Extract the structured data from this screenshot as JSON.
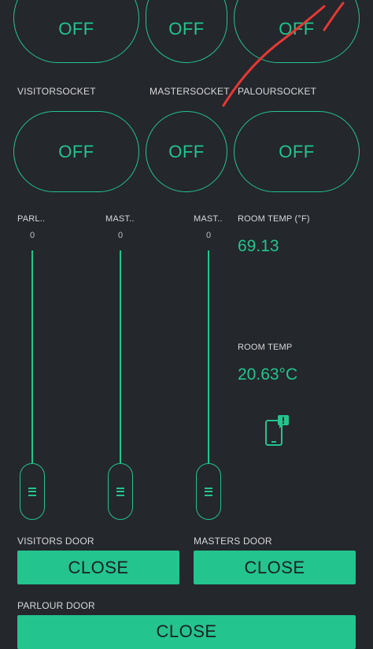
{
  "colors": {
    "background": "#24272c",
    "accent": "#23c48e",
    "annotation": "#e53935"
  },
  "top_switches": [
    {
      "label": "",
      "state": "OFF"
    },
    {
      "label": "",
      "state": "OFF"
    },
    {
      "label": "",
      "state": "OFF"
    }
  ],
  "socket_switches": [
    {
      "label": "VISITORSOCKET",
      "state": "OFF"
    },
    {
      "label": "MASTERSOCKET",
      "state": "OFF"
    },
    {
      "label": "PALOURSOCKET",
      "state": "OFF"
    }
  ],
  "sliders": [
    {
      "label": "PARL..",
      "value": "0",
      "level": 0
    },
    {
      "label": "MAST..",
      "value": "0",
      "level": 0
    },
    {
      "label": "MAST..",
      "value": "0",
      "level": 0
    }
  ],
  "room_temp_f": {
    "label": "ROOM TEMP (°F)",
    "value": "69.13"
  },
  "room_temp_c": {
    "label": "ROOM TEMP",
    "value": "20.63°C"
  },
  "notification_icon": "phone-alert-icon",
  "doors": [
    {
      "label": "VISITORS DOOR",
      "button": "CLOSE"
    },
    {
      "label": "MASTERS DOOR",
      "button": "CLOSE"
    },
    {
      "label": "PARLOUR DOOR",
      "button": "CLOSE"
    }
  ]
}
